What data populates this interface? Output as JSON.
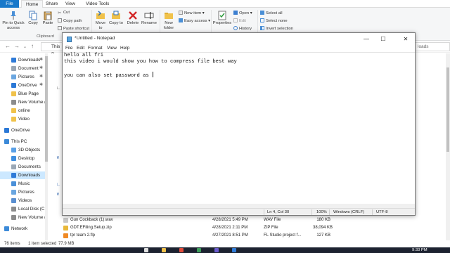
{
  "explorer": {
    "tabs": [
      "File",
      "Home",
      "Share",
      "View",
      "Video Tools"
    ],
    "ribbon": {
      "pin_label": "Pin to Quick access",
      "copy_label": "Copy",
      "paste_label": "Paste",
      "cut_label": "Cut",
      "copy_path_label": "Copy path",
      "paste_shortcut_label": "Paste shortcut",
      "clipboard_group": "Clipboard",
      "move_to_label": "Move to",
      "copy_to_label": "Copy to",
      "delete_label": "Delete",
      "rename_label": "Rename",
      "new_folder_label": "New folder",
      "new_item_label": "New item",
      "easy_access_label": "Easy access",
      "properties_label": "Properties",
      "open_label": "Open",
      "edit_label": "Edit",
      "history_label": "History",
      "select_all_label": "Select all",
      "select_none_label": "Select none",
      "invert_selection_label": "Invert selection"
    },
    "address_fragment": "This P",
    "search_placeholder": "loads",
    "nav_items": [
      {
        "label": "Downloads",
        "color": "#2f7bd8",
        "pinned": true
      },
      {
        "label": "Document",
        "color": "#9aa7b5",
        "pinned": true
      },
      {
        "label": "Pictures",
        "color": "#6aa6e0",
        "pinned": true
      },
      {
        "label": "OneDrive",
        "color": "#2b78d6",
        "pinned": true
      },
      {
        "label": "Blue Page",
        "color": "#f0c24b",
        "pinned": false
      },
      {
        "label": "New Volume (",
        "color": "#8c8c8c",
        "pinned": false
      },
      {
        "label": "online",
        "color": "#f0c24b",
        "pinned": false
      },
      {
        "label": "Video",
        "color": "#f0c24b",
        "pinned": false
      },
      {
        "label": "OneDrive",
        "color": "#2b78d6",
        "pinned": false
      },
      {
        "label": "This PC",
        "color": "#3c8ad8",
        "pinned": false
      },
      {
        "label": "3D Objects",
        "color": "#5aa0e6",
        "pinned": false
      },
      {
        "label": "Desktop",
        "color": "#3f8fe0",
        "pinned": false
      },
      {
        "label": "Documents",
        "color": "#9aa7b5",
        "pinned": false
      },
      {
        "label": "Downloads",
        "color": "#2f7bd8",
        "pinned": false
      },
      {
        "label": "Music",
        "color": "#4a90d9",
        "pinned": false
      },
      {
        "label": "Pictures",
        "color": "#6aa6e0",
        "pinned": false
      },
      {
        "label": "Videos",
        "color": "#5a8fd0",
        "pinned": false
      },
      {
        "label": "Local Disk (C:)",
        "color": "#8c8c8c",
        "pinned": false
      },
      {
        "label": "New Volume (",
        "color": "#8c8c8c",
        "pinned": false
      },
      {
        "label": "Network",
        "color": "#3c8ad8",
        "pinned": false
      }
    ],
    "files": [
      {
        "name": "Gun Cockback (1).wav",
        "date": "4/28/2021 5:49 PM",
        "type": "WAV File",
        "size": "180 KB",
        "color": "#c9c9c9"
      },
      {
        "name": "GDT.EFiling.Setup.zip",
        "date": "4/28/2021 2:11 PM",
        "type": "ZIP File",
        "size": "38,094 KB",
        "color": "#e8b83a"
      },
      {
        "name": "tpr team 2.flp",
        "date": "4/27/2021 8:51 PM",
        "type": "FL Studio project f...",
        "size": "127 KB",
        "color": "#f08a24"
      }
    ],
    "status": {
      "items_count": "76 items",
      "selected": "1 item selected",
      "size": "77.9 MB"
    }
  },
  "taskbar": {
    "time": "9:33 PM"
  },
  "notepad": {
    "title": "*Untitled - Notepad",
    "menu": [
      "File",
      "Edit",
      "Format",
      "View",
      "Help"
    ],
    "lines": [
      "hello all fri",
      "this video i would show you how to compress file best way",
      "",
      "you can also set password as "
    ],
    "status": {
      "position": "Ln 4, Col 30",
      "zoom": "100%",
      "line_ending": "Windows (CRLF)",
      "encoding": "UTF-8"
    }
  }
}
